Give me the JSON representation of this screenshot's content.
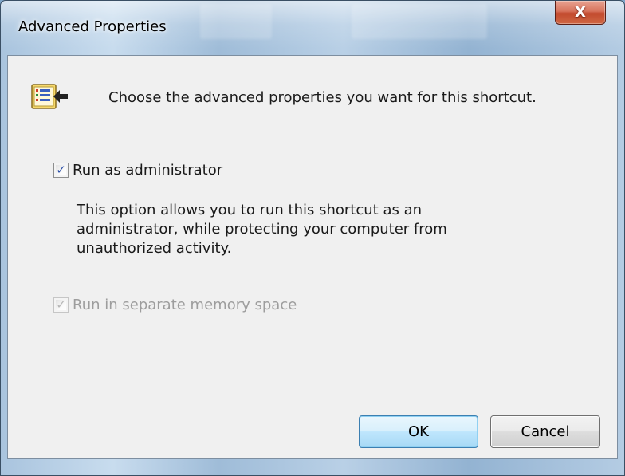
{
  "window": {
    "title": "Advanced Properties",
    "close_glyph": "X"
  },
  "header": {
    "icon": "advanced-properties-icon",
    "text": "Choose the advanced properties you want for this shortcut."
  },
  "options": {
    "run_as_admin": {
      "label": "Run as administrator",
      "checked": true,
      "enabled": true
    },
    "description": "This option allows you to run this shortcut as an administrator, while protecting your computer from unauthorized activity.",
    "separate_memory": {
      "label": "Run in separate memory space",
      "checked": true,
      "enabled": false
    }
  },
  "buttons": {
    "ok_label": "OK",
    "cancel_label": "Cancel"
  },
  "colors": {
    "dialog_bg": "#f0f0f0",
    "close_button": "#c24a2e",
    "checkmark": "#2b4fa8",
    "ok_focus_border": "#3c7fb1"
  }
}
